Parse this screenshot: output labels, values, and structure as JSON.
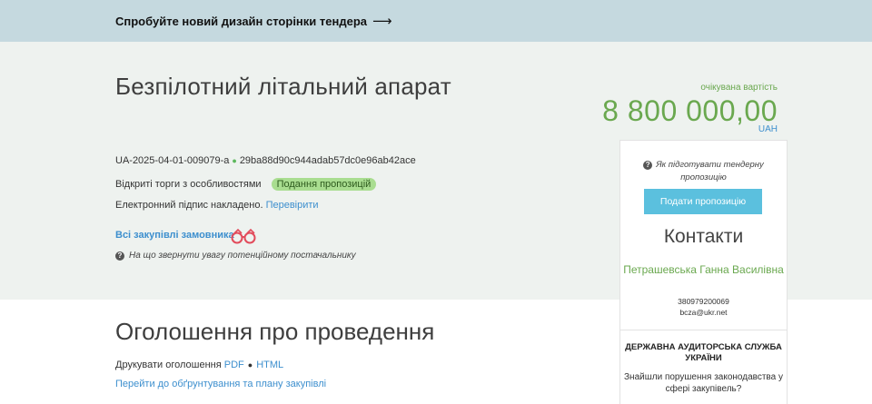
{
  "banner": {
    "text": "Спробуйте новий дизайн сторінки тендера",
    "arrow": "⟶"
  },
  "tender": {
    "title": "Безпілотний літальний апарат",
    "id": "UA-2025-04-01-009079-a",
    "hash": "29ba88d90c944adab57dc0e96ab42ace",
    "procedure": "Відкриті торги з особливостями",
    "status": "Подання пропозицій",
    "signature_text": "Електронний підпис накладено.",
    "verify_link": "Перевірити",
    "all_purchases_link": "Всі закупівлі замовника",
    "attention_text": "На що звернути увагу потенційному постачальнику"
  },
  "price": {
    "label": "очікувана вартість",
    "amount": "8 800 000,00",
    "currency": "UAH"
  },
  "sidebar": {
    "prepare_help": "Як підготувати тендерну пропозицію",
    "submit_button": "Подати пропозицію",
    "contacts_title": "Контакти",
    "contact_name": "Петрашевська Ганна Василівна",
    "phone": "380979200069",
    "email": "bcza@ukr.net",
    "audit_title": "ДЕРЖАВНА АУДИТОРСЬКА СЛУЖБА УКРАЇНИ",
    "audit_question": "Знайшли порушення законодавства у сфері закупівель?"
  },
  "announcement": {
    "title": "Оголошення про проведення",
    "print_label": "Друкувати оголошення",
    "pdf_link": "PDF",
    "html_link": "HTML",
    "plan_link": "Перейти до обґрунтування та плану закупівлі"
  },
  "colors": {
    "banner_bg": "#c5d9df",
    "hero_bg": "#eef2ef",
    "accent_green": "#6aa84f",
    "link_blue": "#3d8fce",
    "button_blue": "#5bc0de",
    "status_badge": "#a9dd90"
  },
  "icons": [
    "arrow-right-icon",
    "question-circle-icon",
    "binoculars-icon"
  ]
}
